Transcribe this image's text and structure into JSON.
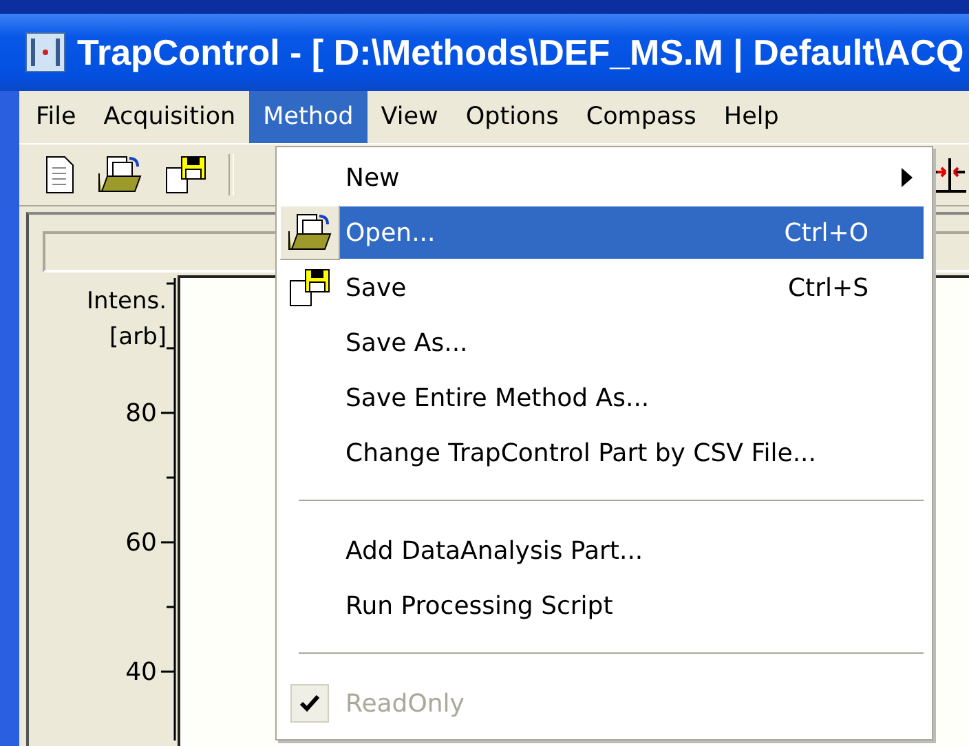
{
  "window": {
    "title": "TrapControl - [ D:\\Methods\\DEF_MS.M | Default\\ACQ"
  },
  "menubar": [
    {
      "label": "File",
      "selected": false
    },
    {
      "label": "Acquisition",
      "selected": false
    },
    {
      "label": "Method",
      "selected": true
    },
    {
      "label": "View",
      "selected": false
    },
    {
      "label": "Options",
      "selected": false
    },
    {
      "label": "Compass",
      "selected": false
    },
    {
      "label": "Help",
      "selected": false
    }
  ],
  "menu": [
    {
      "kind": "item",
      "label": "New",
      "submenu": true,
      "selected": false
    },
    {
      "kind": "item",
      "label": "Open...",
      "shortcut": "Ctrl+O",
      "selected": true
    },
    {
      "kind": "item",
      "label": "Save",
      "shortcut": "Ctrl+S",
      "selected": false
    },
    {
      "kind": "item",
      "label": "Save As...",
      "selected": false
    },
    {
      "kind": "item",
      "label": "Save Entire Method As...",
      "selected": false
    },
    {
      "kind": "item",
      "label": "Change TrapControl Part by CSV File...",
      "selected": false
    },
    {
      "kind": "separator"
    },
    {
      "kind": "item",
      "label": "Add DataAnalysis Part...",
      "selected": false
    },
    {
      "kind": "item",
      "label": "Run Processing Script",
      "selected": false
    },
    {
      "kind": "separator"
    },
    {
      "kind": "item",
      "label": "ReadOnly",
      "checked": true,
      "disabled": true,
      "selected": false
    }
  ],
  "plot": {
    "y_label": [
      "Intens.",
      "[arb]"
    ],
    "y_ticks": [
      "80",
      "60",
      "40"
    ]
  }
}
